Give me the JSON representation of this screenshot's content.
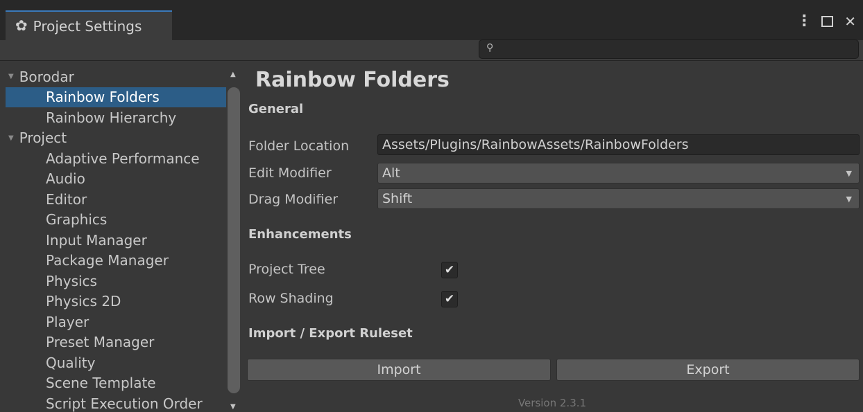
{
  "window": {
    "tab_title": "Project Settings",
    "tab_icon": "gear-icon",
    "controls": {
      "menu": "⋮",
      "maximize": "",
      "close": "✕"
    }
  },
  "search": {
    "value": "",
    "placeholder": ""
  },
  "sidebar": {
    "items": [
      {
        "label": "Borodar",
        "type": "group"
      },
      {
        "label": "Rainbow Folders",
        "type": "child",
        "selected": true
      },
      {
        "label": "Rainbow Hierarchy",
        "type": "child"
      },
      {
        "label": "Project",
        "type": "group"
      },
      {
        "label": "Adaptive Performance",
        "type": "child"
      },
      {
        "label": "Audio",
        "type": "child"
      },
      {
        "label": "Editor",
        "type": "child"
      },
      {
        "label": "Graphics",
        "type": "child"
      },
      {
        "label": "Input Manager",
        "type": "child"
      },
      {
        "label": "Package Manager",
        "type": "child"
      },
      {
        "label": "Physics",
        "type": "child"
      },
      {
        "label": "Physics 2D",
        "type": "child"
      },
      {
        "label": "Player",
        "type": "child"
      },
      {
        "label": "Preset Manager",
        "type": "child"
      },
      {
        "label": "Quality",
        "type": "child"
      },
      {
        "label": "Scene Template",
        "type": "child"
      },
      {
        "label": "Script Execution Order",
        "type": "child"
      }
    ]
  },
  "main": {
    "title": "Rainbow Folders",
    "general": {
      "heading": "General",
      "folder_location_label": "Folder Location",
      "folder_location_value": "Assets/Plugins/RainbowAssets/RainbowFolders",
      "edit_modifier_label": "Edit Modifier",
      "edit_modifier_value": "Alt",
      "drag_modifier_label": "Drag Modifier",
      "drag_modifier_value": "Shift"
    },
    "enhancements": {
      "heading": "Enhancements",
      "project_tree_label": "Project Tree",
      "project_tree_checked": true,
      "row_shading_label": "Row Shading",
      "row_shading_checked": true
    },
    "ruleset": {
      "heading": "Import / Export Ruleset",
      "import_label": "Import",
      "export_label": "Export"
    },
    "version": "Version 2.3.1"
  },
  "colors": {
    "accent": "#3a79bb",
    "selection": "#2c5d87",
    "background": "#383838"
  }
}
